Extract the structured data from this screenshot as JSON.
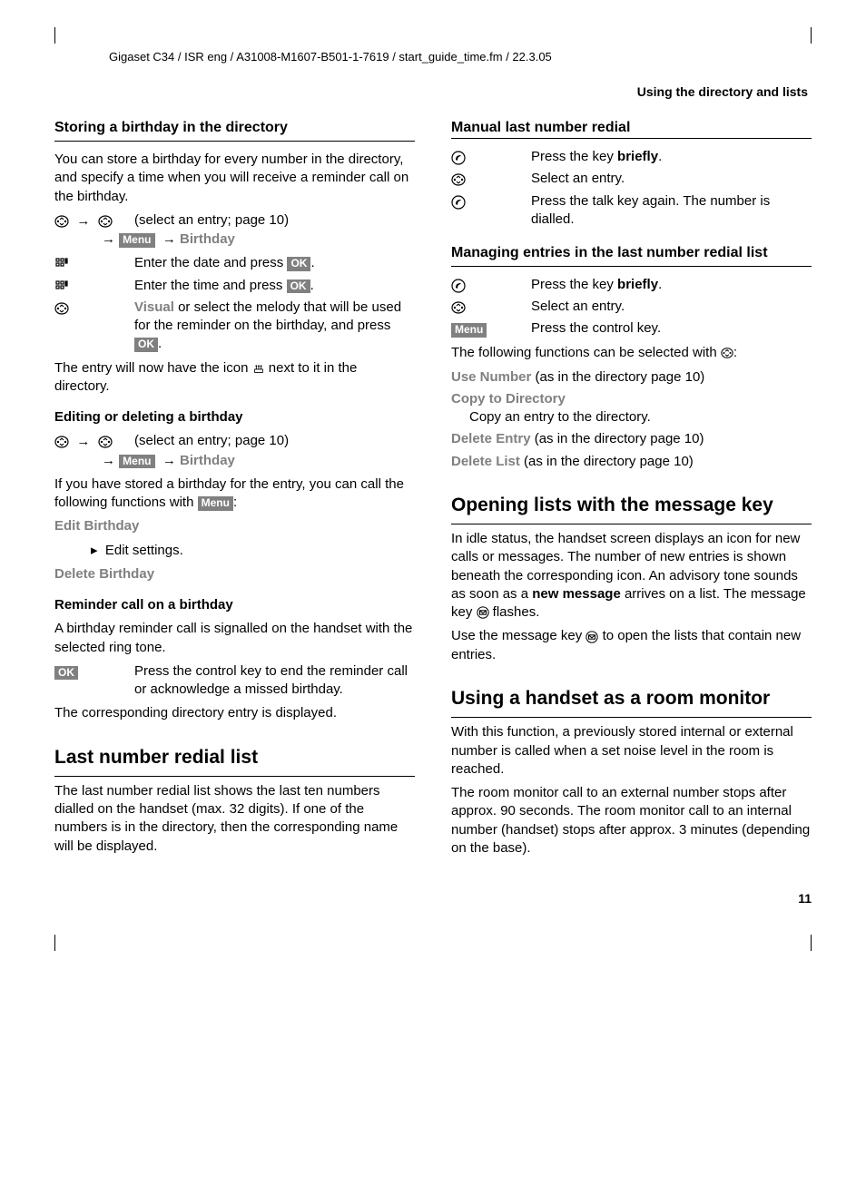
{
  "header": "Gigaset C34 / ISR eng / A31008-M1607-B501-1-7619 / start_guide_time.fm / 22.3.05",
  "sectionTitle": "Using the directory and lists",
  "pageNumber": "11",
  "labels": {
    "menu": "Menu",
    "ok": "OK",
    "birthday": "Birthday",
    "visual": "Visual"
  },
  "left": {
    "h_storing": "Storing a birthday in the directory",
    "p_storing": "You can store a birthday for every number in the directory, and specify a time when you will receive a reminder call on the birthday.",
    "nav_select_entry": "(select an entry; page 10)",
    "step_date_a": "Enter the date and press ",
    "step_time_a": "Enter the time and press ",
    "step_visual_b": " or select the melody that will be used for the reminder on the birthday, and press ",
    "p_after_icon_a": "The entry will now have the icon ",
    "p_after_icon_b": " next to it in the directory.",
    "h_editing": "Editing or deleting a birthday",
    "p_if_stored_a": "If you have stored a birthday for the entry, you can call the following functions with ",
    "p_if_stored_b": ":",
    "grey_edit": "Edit Birthday",
    "bullet_edit": "Edit settings.",
    "grey_delete": "Delete Birthday",
    "h_reminder": "Reminder call on a birthday",
    "p_reminder": "A birthday reminder call is signalled on the handset with the selected ring tone.",
    "step_ok_end": "Press the control key to end the reminder call or acknowledge a missed birthday.",
    "p_displayed": "The corresponding directory entry is displayed.",
    "h_lastnum": "Last number redial list",
    "p_lastnum": "The last number redial list shows the last ten numbers dialled on the handset (max. 32 digits). If one of the numbers is in the directory, then the corresponding name will be displayed."
  },
  "right": {
    "h_manual": "Manual last number redial",
    "step_press_brief_a": "Press the key ",
    "step_press_brief_b": "briefly",
    "step_press_brief_c": ".",
    "step_select": "Select an entry.",
    "step_talk_again": "Press the talk key again. The number is dialled.",
    "h_managing": "Managing entries in the last number redial list",
    "step_press_control": "Press the control key.",
    "p_following_a": "The following functions can be selected with ",
    "p_following_b": ":",
    "grey_use": "Use Number",
    "txt_use": " (as in the directory page 10)",
    "grey_copy": "Copy to Directory",
    "txt_copy": "Copy an entry to the directory.",
    "grey_delentry": "Delete Entry",
    "txt_delentry": " (as in the directory page 10)",
    "grey_dellist": "Delete List",
    "txt_dellist": " (as in the directory page 10)",
    "h_opening": "Opening lists with the message key",
    "p_opening_a": "In idle status, the handset screen displays an icon for new calls or messages. The number of new entries is shown beneath the corresponding icon. An advisory tone sounds as soon as a ",
    "p_opening_bold": "new message",
    "p_opening_b": " arrives on a list. The message key ",
    "p_opening_c": " flashes.",
    "p_opening2_a": "Use the message key ",
    "p_opening2_b": " to open the lists that contain new entries.",
    "h_room": "Using a handset as a room monitor",
    "p_room1": "With this function, a previously stored internal or external number is called when a set noise level in the room is reached.",
    "p_room2": "The room monitor call to an external number stops after approx. 90 seconds. The room monitor call to an internal number (handset) stops after approx. 3 minutes (depending on the base)."
  }
}
